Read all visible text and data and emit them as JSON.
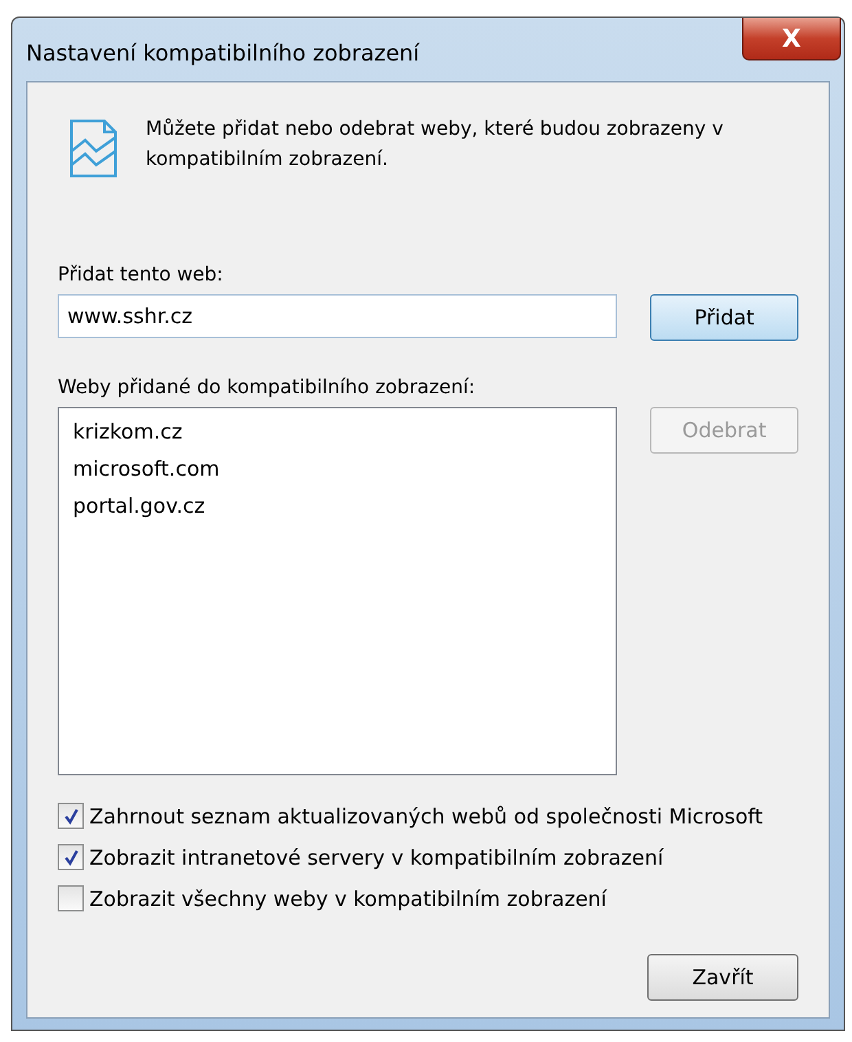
{
  "window": {
    "title": "Nastavení kompatibilního zobrazení",
    "close_label": "X"
  },
  "info": "Můžete přidat nebo odebrat weby, které budou zobrazeny v kompatibilním zobrazení.",
  "add": {
    "label": "Přidat tento web:",
    "value": "www.sshr.cz",
    "button": "Přidat"
  },
  "list": {
    "label": "Weby přidané do kompatibilního zobrazení:",
    "items": [
      "krizkom.cz",
      "microsoft.com",
      "portal.gov.cz"
    ],
    "remove_button": {
      "label": "Odebrat",
      "disabled": true
    }
  },
  "options": [
    {
      "label": "Zahrnout seznam aktualizovaných webů od společnosti Microsoft",
      "checked": true
    },
    {
      "label": "Zobrazit intranetové servery v kompatibilním zobrazení",
      "checked": true
    },
    {
      "label": "Zobrazit všechny weby v kompatibilním zobrazení",
      "checked": false
    }
  ],
  "close_button": "Zavřít"
}
